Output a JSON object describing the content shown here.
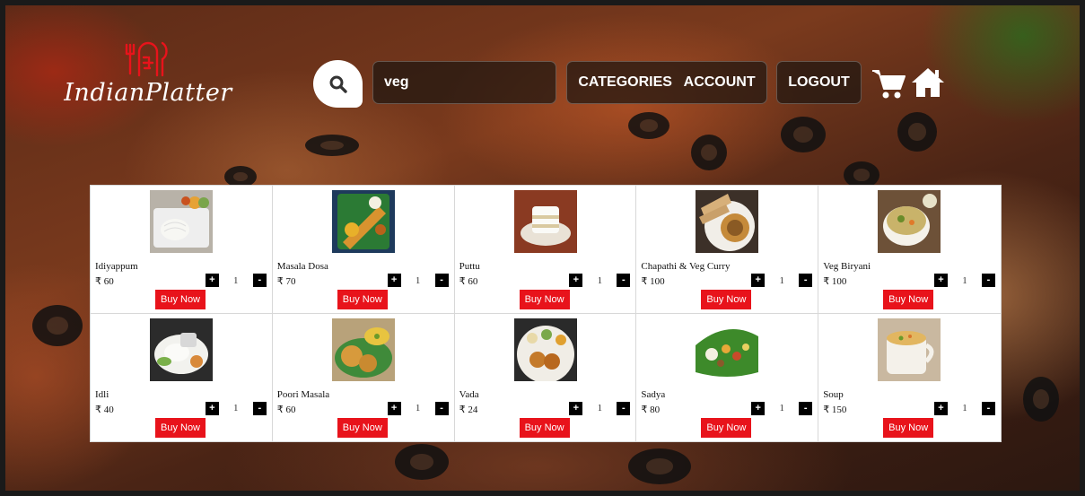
{
  "brand": {
    "name": "IndianPlatter"
  },
  "search": {
    "value": "veg",
    "icon": "search-icon"
  },
  "nav": {
    "categories": "CATEGORIES",
    "account": "ACCOUNT",
    "logout": "LOGOUT"
  },
  "icons": {
    "cart": "cart-icon",
    "home": "home-icon"
  },
  "colors": {
    "buy_button": "#e8131b",
    "qty_button": "#000000"
  },
  "currency": "₹",
  "products": [
    {
      "name": "Idiyappum",
      "price": "₹ 60",
      "qty": "1",
      "buy_label": "Buy Now"
    },
    {
      "name": "Masala Dosa",
      "price": "₹ 70",
      "qty": "1",
      "buy_label": "Buy Now"
    },
    {
      "name": "Puttu",
      "price": "₹ 60",
      "qty": "1",
      "buy_label": "Buy Now"
    },
    {
      "name": "Chapathi & Veg Curry",
      "price": "₹ 100",
      "qty": "1",
      "buy_label": "Buy Now"
    },
    {
      "name": "Veg Biryani",
      "price": "₹ 100",
      "qty": "1",
      "buy_label": "Buy Now"
    },
    {
      "name": "Idli",
      "price": "₹ 40",
      "qty": "1",
      "buy_label": "Buy Now"
    },
    {
      "name": "Poori Masala",
      "price": "₹ 60",
      "qty": "1",
      "buy_label": "Buy Now"
    },
    {
      "name": "Vada",
      "price": "₹ 24",
      "qty": "1",
      "buy_label": "Buy Now"
    },
    {
      "name": "Sadya",
      "price": "₹ 80",
      "qty": "1",
      "buy_label": "Buy Now"
    },
    {
      "name": "Soup",
      "price": "₹ 150",
      "qty": "1",
      "buy_label": "Buy Now"
    }
  ],
  "qty_controls": {
    "plus": "+",
    "minus": "-"
  }
}
